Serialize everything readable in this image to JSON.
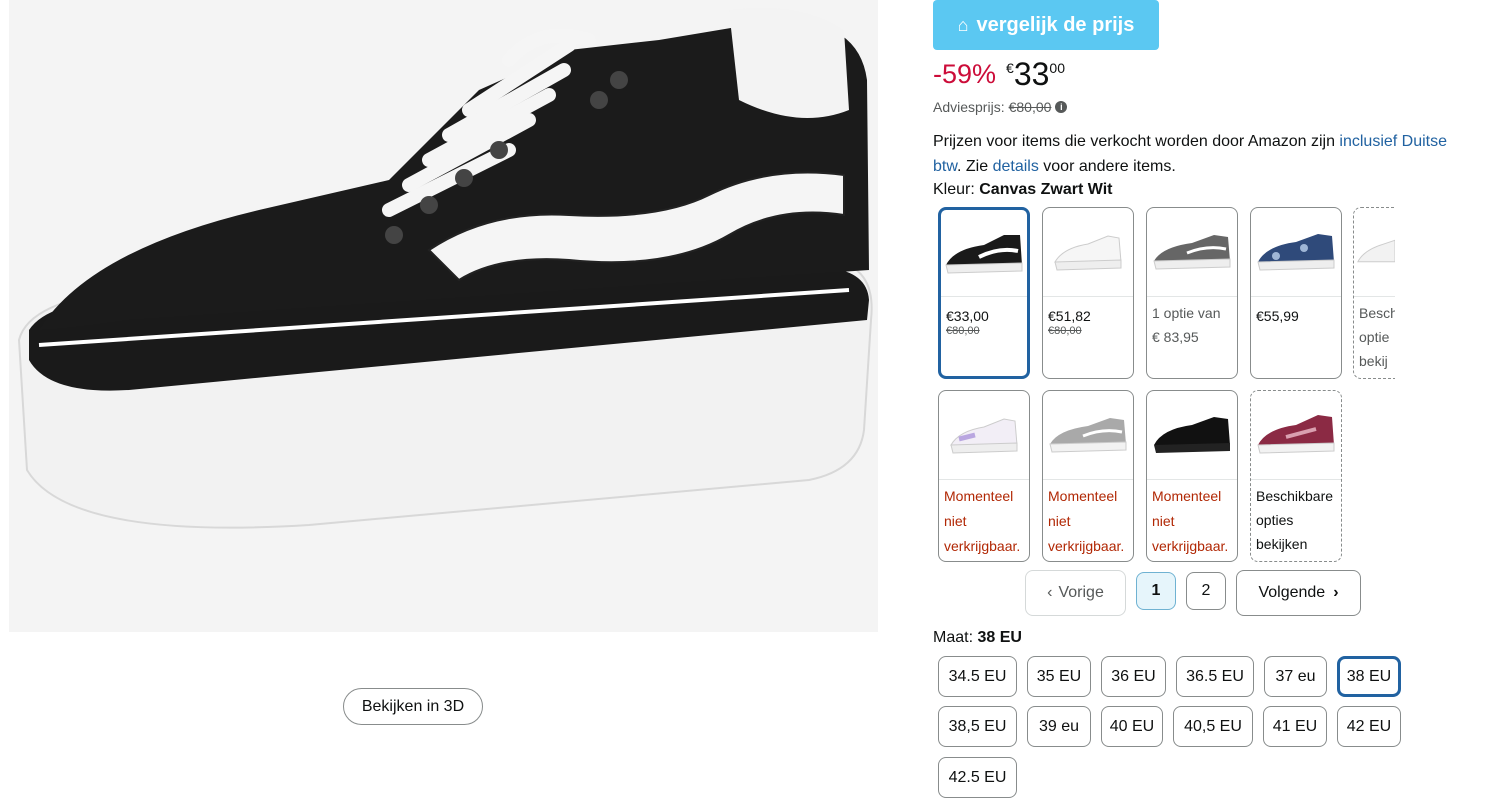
{
  "view3d_label": "Bekijken in 3D",
  "compare_label": "vergelijk de prijs",
  "price": {
    "discount": "-59%",
    "currency": "€",
    "whole": "33",
    "fraction": "00"
  },
  "advies": {
    "label": "Adviesprijs:",
    "value": "€80,00"
  },
  "vat": {
    "t1": "Prijzen voor items die verkocht worden door Amazon zijn ",
    "link1": "inclusief Duitse btw",
    "t2": ". Zie ",
    "link2": "details",
    "t3": " voor andere items."
  },
  "color": {
    "label": "Kleur: ",
    "value": "Canvas Zwart Wit"
  },
  "swatches": [
    {
      "price": "€33,00",
      "strike": "€80,00"
    },
    {
      "price": "€51,82",
      "strike": "€80,00"
    },
    {
      "line1": "1 optie van",
      "line2": "€ 83,95"
    },
    {
      "price": "€55,99"
    },
    {
      "line1": "Besch",
      "line2": "optie",
      "line3": "bekij"
    },
    {
      "l1": "Momenteel",
      "l2": "niet",
      "l3": "verkrijgbaar."
    },
    {
      "l1": "Momenteel",
      "l2": "niet",
      "l3": "verkrijgbaar."
    },
    {
      "l1": "Momenteel",
      "l2": "niet",
      "l3": "verkrijgbaar."
    },
    {
      "l1": "Beschikbare",
      "l2": "opties",
      "l3": "bekijken"
    }
  ],
  "pagination": {
    "prev": "Vorige",
    "p1": "1",
    "p2": "2",
    "next": "Volgende"
  },
  "size": {
    "label": "Maat: ",
    "value": "38 EU",
    "options": [
      "34.5 EU",
      "35 EU",
      "36 EU",
      "36.5 EU",
      "37 eu",
      "38 EU",
      "38,5 EU",
      "39 eu",
      "40 EU",
      "40,5 EU",
      "41 EU",
      "42 EU",
      "42.5 EU"
    ]
  },
  "colors": {
    "accent": "#2162a1",
    "deal": "#cc0c39",
    "compare_bg": "#5bc8f2"
  }
}
